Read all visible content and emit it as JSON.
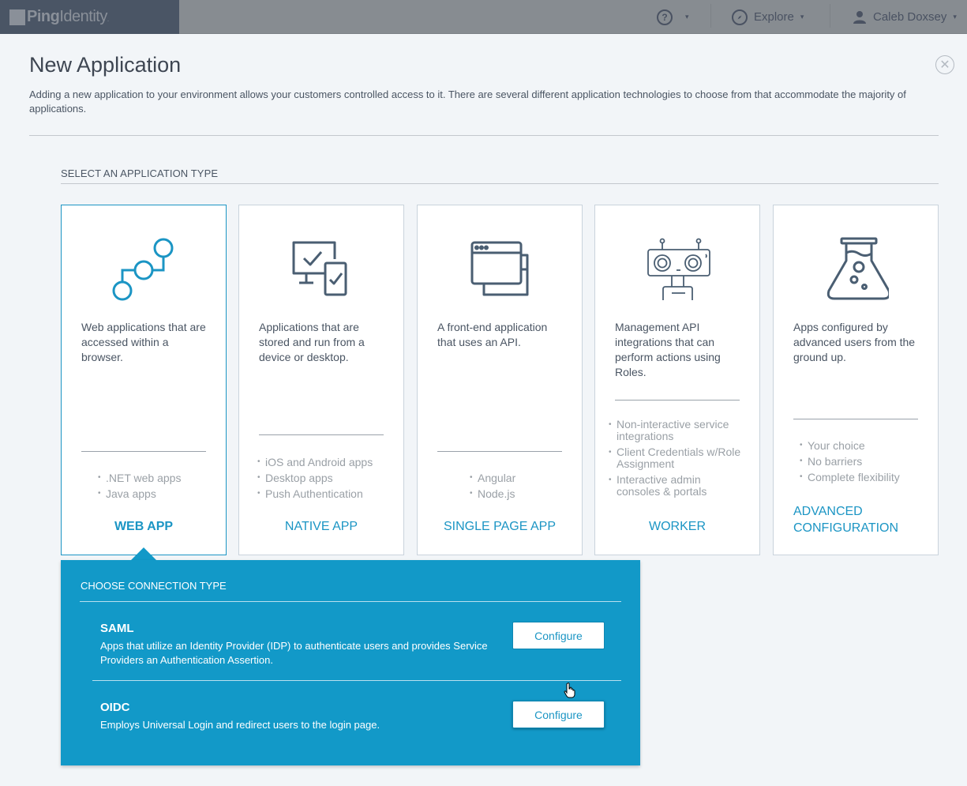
{
  "topbar": {
    "brand_bold": "Ping",
    "brand_light": "Identity",
    "help_icon": "question-circle-icon",
    "help_glyph": "?",
    "explore_label": "Explore",
    "explore_icon": "compass-icon",
    "user_name": "Caleb Doxsey",
    "user_icon": "user-icon",
    "caret": "▾"
  },
  "modal": {
    "title": "New Application",
    "close_glyph": "✕",
    "description": "Adding a new application to your environment allows your customers controlled access to it. There are several different application technologies to choose from that accommodate the majority of applications.",
    "section_label": "SELECT AN APPLICATION TYPE"
  },
  "app_types": [
    {
      "icon": "web-app-nodes-icon",
      "description": "Web applications that are accessed within a browser.",
      "bullets": [
        ".NET web apps",
        "Java apps"
      ],
      "title": "WEB APP",
      "selected": true
    },
    {
      "icon": "desktop-device-check-icon",
      "description": "Applications that are stored and run from a device or desktop.",
      "bullets": [
        "iOS and Android apps",
        "Desktop apps",
        "Push Authentication"
      ],
      "title": "NATIVE APP",
      "selected": false
    },
    {
      "icon": "browser-windows-icon",
      "description": "A front-end application that uses an API.",
      "bullets": [
        "Angular",
        "Node.js"
      ],
      "title": "SINGLE PAGE APP",
      "selected": false
    },
    {
      "icon": "robot-icon",
      "description": "Management API integrations that can perform actions using Roles.",
      "bullets": [
        "Non-interactive service integrations",
        "Client Credentials w/Role Assignment",
        "Interactive admin consoles & portals"
      ],
      "title": "WORKER",
      "selected": false
    },
    {
      "icon": "flask-icon",
      "description": "Apps configured by advanced users from the ground up.",
      "bullets": [
        "Your choice",
        "No barriers",
        "Complete flexibility"
      ],
      "title": "ADVANCED CONFIGURATION",
      "selected": false
    }
  ],
  "connection": {
    "label": "CHOOSE CONNECTION TYPE",
    "options": [
      {
        "title": "SAML",
        "description": "Apps that utilize an Identity Provider (IDP) to authenticate users and provides Service Providers an Authentication Assertion.",
        "button": "Configure"
      },
      {
        "title": "OIDC",
        "description": "Employs Universal Login and redirect users to the login page.",
        "button": "Configure"
      }
    ]
  },
  "colors": {
    "accent": "#1b95c4",
    "panel": "#1299c8",
    "icon_dark": "#4a5e72"
  }
}
